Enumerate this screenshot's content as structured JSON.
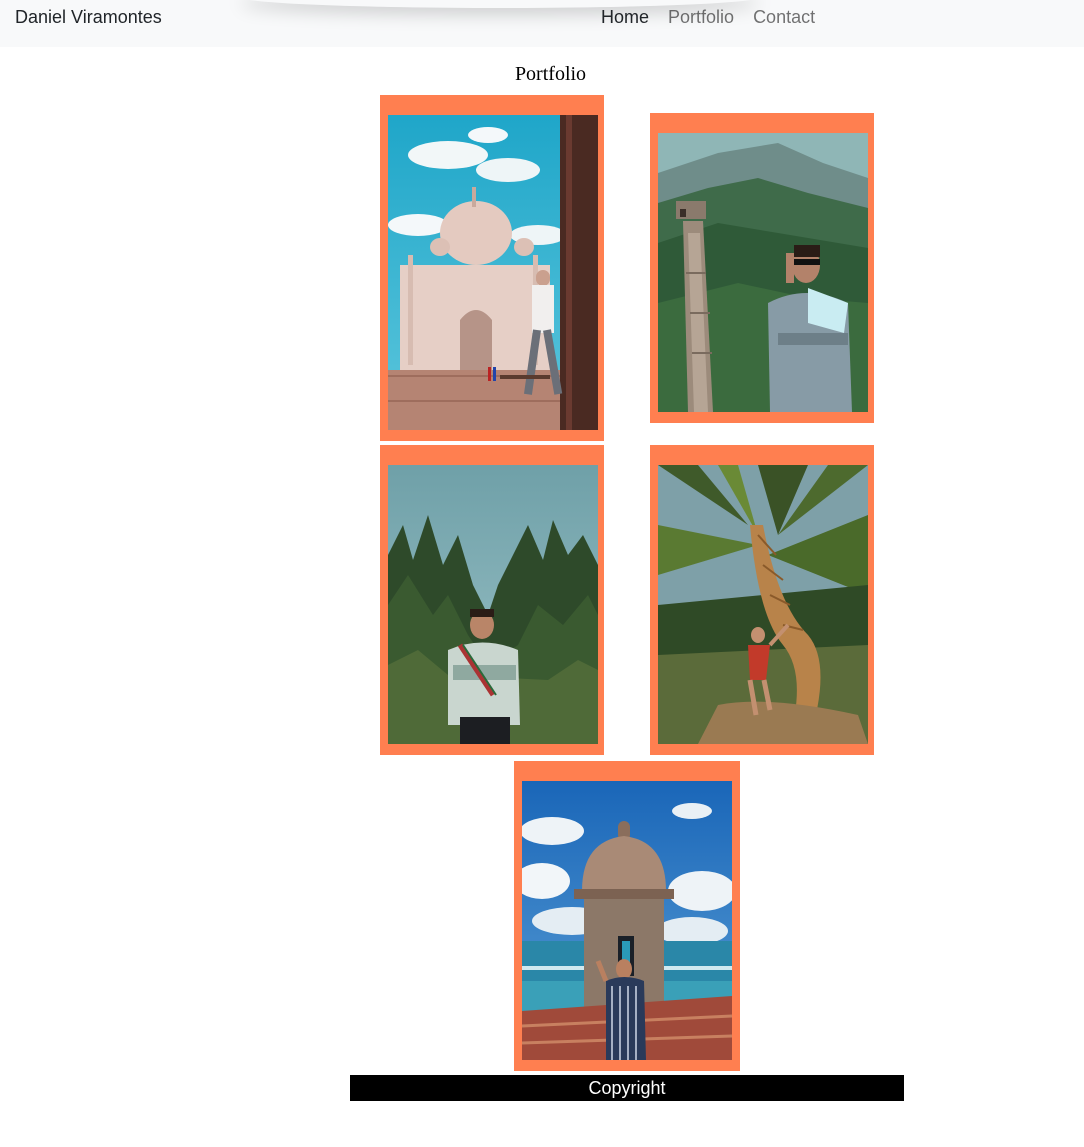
{
  "navbar": {
    "brand": "Daniel Viramontes",
    "links": [
      {
        "label": "Home"
      },
      {
        "label": "Portfolio"
      },
      {
        "label": "Contact"
      }
    ]
  },
  "main": {
    "title": "Portfolio"
  },
  "footer": {
    "text": "Copyright"
  },
  "colors": {
    "frame": "#ff7f50",
    "navbar_bg": "#f8f9fa",
    "footer_bg": "#000000",
    "footer_text": "#ffffff"
  }
}
